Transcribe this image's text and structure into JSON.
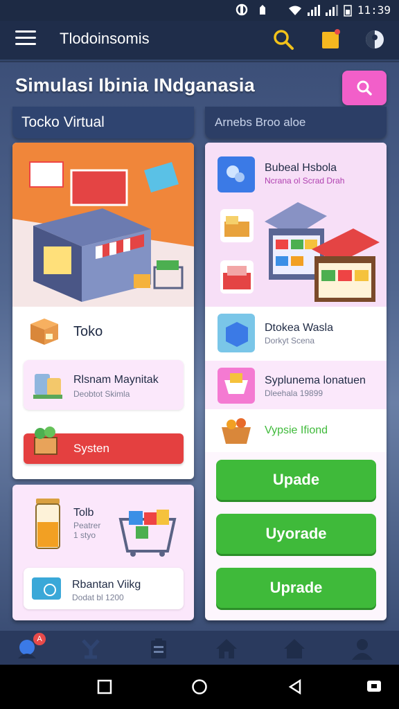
{
  "status_bar": {
    "time": "11:39"
  },
  "header": {
    "title": "Tlodoinsomis"
  },
  "page": {
    "title": "Simulasi Ibinia INdganasia"
  },
  "tabs": {
    "left": "Tocko Virtual",
    "right": "Arnebs Broo aloe"
  },
  "left_card": {
    "store_label": "Toko",
    "item": {
      "title": "Rlsnam Maynitak",
      "subtitle": "Deobtot Skimla"
    },
    "red_button": "Systen"
  },
  "left_bottom_card": {
    "item1": {
      "title": "Tolb",
      "line2": "Peatrer",
      "line3": "1 styo"
    },
    "item2": {
      "title": "Rbantan Viikg",
      "subtitle": "Dodat bl 1200"
    }
  },
  "right_card": {
    "item1": {
      "title": "Bubeal Hsbola",
      "subtitle": "Ncrana ol Scrad Drah"
    },
    "item2": {
      "title": "Dtokea Wasla",
      "subtitle": "Dorkyt Scena"
    },
    "item3": {
      "title": "Syplunema lonatuen",
      "subtitle": "Dleehala 19899"
    },
    "item4": {
      "title": "Vypsie Ifiond"
    },
    "buttons": [
      "Upade",
      "Uyorade",
      "Uprade"
    ]
  },
  "bottom_nav": {
    "badge": "A"
  },
  "colors": {
    "accent_pink": "#f25fc9",
    "green": "#3fba3a",
    "red": "#e44040",
    "navy": "#1f2d4a"
  }
}
